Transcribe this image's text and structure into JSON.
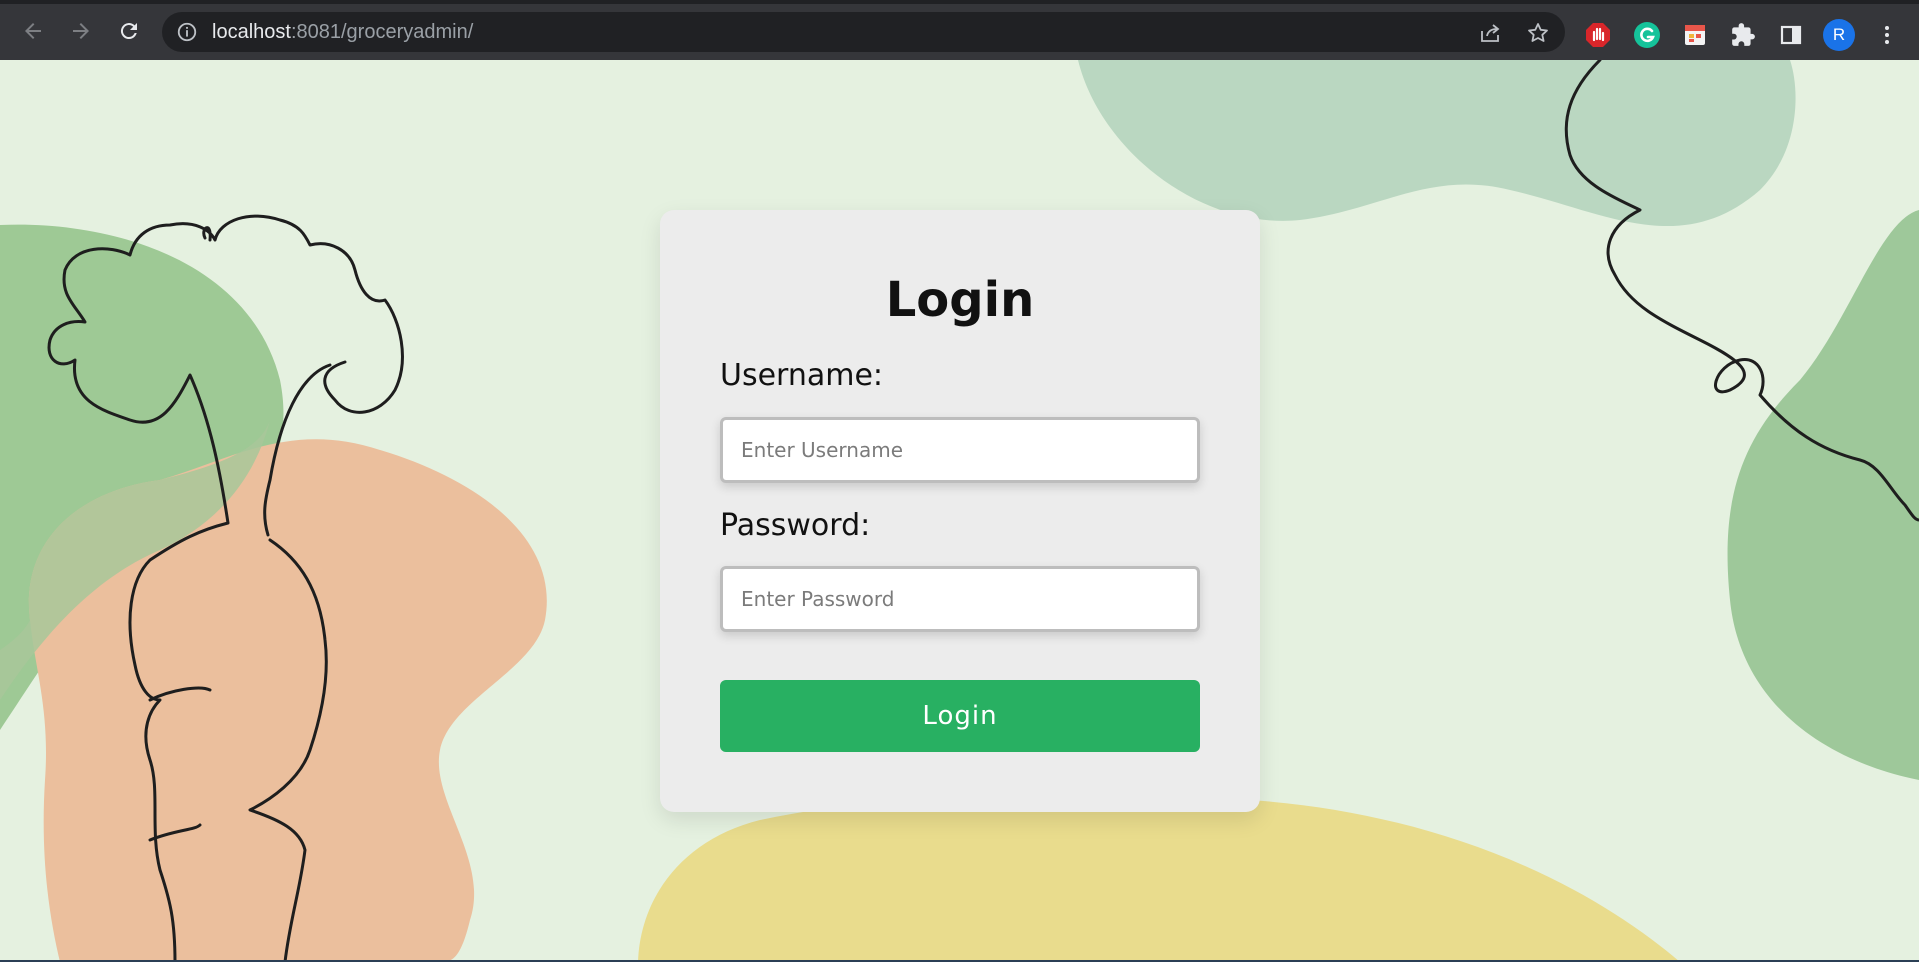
{
  "browser": {
    "url_host": "localhost",
    "url_rest": ":8081/groceryadmin/",
    "profile_initial": "R",
    "accent": "#1a73e8",
    "icons": [
      "back-arrow-icon",
      "forward-arrow-icon",
      "reload-icon",
      "site-info-icon",
      "share-icon",
      "bookmark-star-icon",
      "adblock-hand-icon",
      "grammarly-icon",
      "calendar-extension-icon",
      "extensions-puzzle-icon",
      "side-panel-icon",
      "more-menu-icon"
    ]
  },
  "login": {
    "title": "Login",
    "username_label": "Username:",
    "username_placeholder": "Enter Username",
    "password_label": "Password:",
    "password_placeholder": "Enter Password",
    "button_label": "Login",
    "button_color": "#28b062"
  },
  "page": {
    "background": "#e5f1e0"
  }
}
